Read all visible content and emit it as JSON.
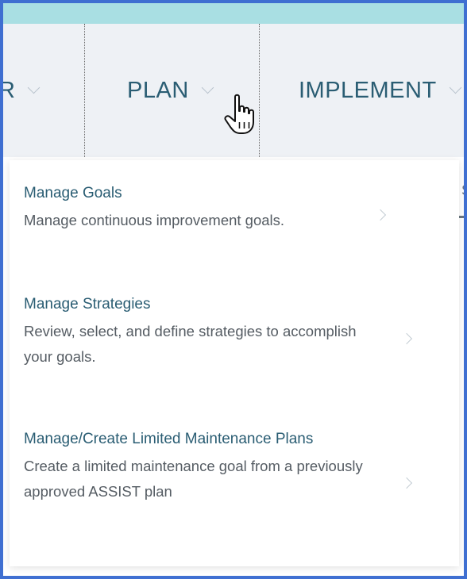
{
  "nav": {
    "items": [
      {
        "label": "R"
      },
      {
        "label": "PLAN"
      },
      {
        "label": "IMPLEMENT"
      }
    ]
  },
  "dropdown": {
    "items": [
      {
        "title": "Manage Goals",
        "description": "Manage continuous improvement goals."
      },
      {
        "title": "Manage Strategies",
        "description": "Review, select, and define strategies to accomplish your goals."
      },
      {
        "title": "Manage/Create Limited Maintenance Plans",
        "description": "Create a limited maintenance goal from a previously approved ASSIST plan"
      }
    ]
  },
  "background": {
    "peek_text": "S"
  },
  "icons": {
    "cursor": "hand-pointer-icon",
    "nav_chevron": "chevron-down-icon",
    "item_chevron": "chevron-right-icon"
  },
  "colors": {
    "frame_border": "#3f6fd1",
    "top_strip": "#a9dfe3",
    "nav_background": "#eef1f5",
    "nav_text": "#2a5d73",
    "title_text": "#2a5d73",
    "description_text": "#555c63"
  }
}
